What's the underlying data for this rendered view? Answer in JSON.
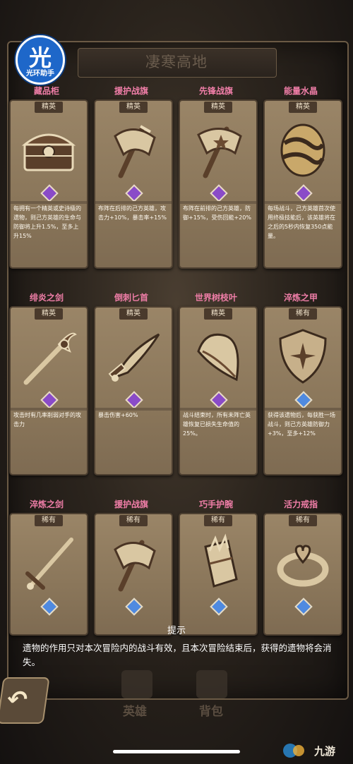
{
  "header": {
    "title": "凄寒高地",
    "logo_char": "光",
    "logo_text": "光环助手"
  },
  "cards": [
    {
      "name": "藏品柜",
      "rarity": "精英",
      "rarity_type": "elite",
      "icon": "treasure-chest-icon",
      "desc": "每拥有一个精英或史诗级的遗物，则己方英雄的生命与防御将上升1.5%，至多上升15%"
    },
    {
      "name": "援护战旗",
      "rarity": "精英",
      "rarity_type": "elite",
      "icon": "war-banner-axe-icon",
      "desc": "布阵在后排的己方英雄，攻击力+10%，暴击率+15%"
    },
    {
      "name": "先锋战旗",
      "rarity": "精英",
      "rarity_type": "elite",
      "icon": "vanguard-banner-axe-icon",
      "desc": "布阵在前排的己方英雄，防御+15%，受伤回能+20%"
    },
    {
      "name": "能量水晶",
      "rarity": "精英",
      "rarity_type": "elite",
      "icon": "energy-crystal-egg-icon",
      "desc": "每场战斗，己方英雄首次使用终极技能后，该英雄将在之后的5秒内恢复350点能量。"
    },
    {
      "name": "绯炎之剑",
      "rarity": "精英",
      "rarity_type": "elite",
      "icon": "flame-sword-icon",
      "desc": "攻击时有几率削弱对手的攻击力"
    },
    {
      "name": "倒刺匕首",
      "rarity": "精英",
      "rarity_type": "elite",
      "icon": "barbed-dagger-icon",
      "desc": "暴击伤害+60%"
    },
    {
      "name": "世界树枝叶",
      "rarity": "精英",
      "rarity_type": "elite",
      "icon": "world-tree-leaf-icon",
      "desc": "战斗结束时，所有未阵亡英雄恢复已损失生命值的25%。"
    },
    {
      "name": "淬炼之甲",
      "rarity": "稀有",
      "rarity_type": "rare",
      "icon": "star-shield-icon",
      "desc": "获得该遗物后，每获胜一场战斗，则己方英雄防御力+3%，至多+12%"
    },
    {
      "name": "淬炼之剑",
      "rarity": "稀有",
      "rarity_type": "rare",
      "icon": "tempered-sword-icon",
      "desc": ""
    },
    {
      "name": "援护战旗",
      "rarity": "稀有",
      "rarity_type": "rare",
      "icon": "war-banner-axe-icon",
      "desc": ""
    },
    {
      "name": "巧手护腕",
      "rarity": "稀有",
      "rarity_type": "rare",
      "icon": "bracer-icon",
      "desc": ""
    },
    {
      "name": "活力戒指",
      "rarity": "稀有",
      "rarity_type": "rare",
      "icon": "heart-ring-icon",
      "desc": ""
    }
  ],
  "hint": {
    "title": "提示",
    "text": "遗物的作用只对本次冒险内的战斗有效，且本次冒险结束后，获得的遗物将会消失。"
  },
  "bottom_nav": {
    "heroes_label": "英雄",
    "bag_label": "背包"
  },
  "watermark": {
    "text": "九游"
  },
  "colors": {
    "elite_gem": "#8a4bc8",
    "rare_gem": "#4f8ae0",
    "card_name": "#f07ea8",
    "card_bg": "#9a8567"
  }
}
